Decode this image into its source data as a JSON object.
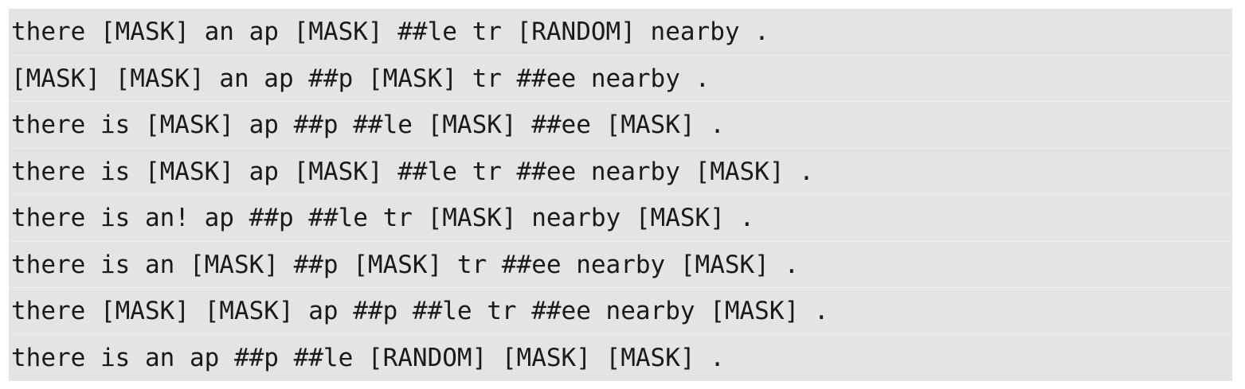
{
  "lines": [
    "there [MASK] an ap [MASK] ##le tr [RANDOM] nearby .",
    "[MASK] [MASK] an ap ##p [MASK] tr ##ee nearby .",
    "there is [MASK] ap ##p ##le [MASK] ##ee [MASK] .",
    "there is [MASK] ap [MASK] ##le tr ##ee nearby [MASK] .",
    "there is an! ap ##p ##le tr [MASK] nearby [MASK] .",
    "there is an [MASK] ##p [MASK] tr ##ee nearby [MASK] .",
    "there [MASK] [MASK] ap ##p ##le tr ##ee nearby [MASK] .",
    "there is an ap ##p ##le [RANDOM] [MASK] [MASK] ."
  ]
}
